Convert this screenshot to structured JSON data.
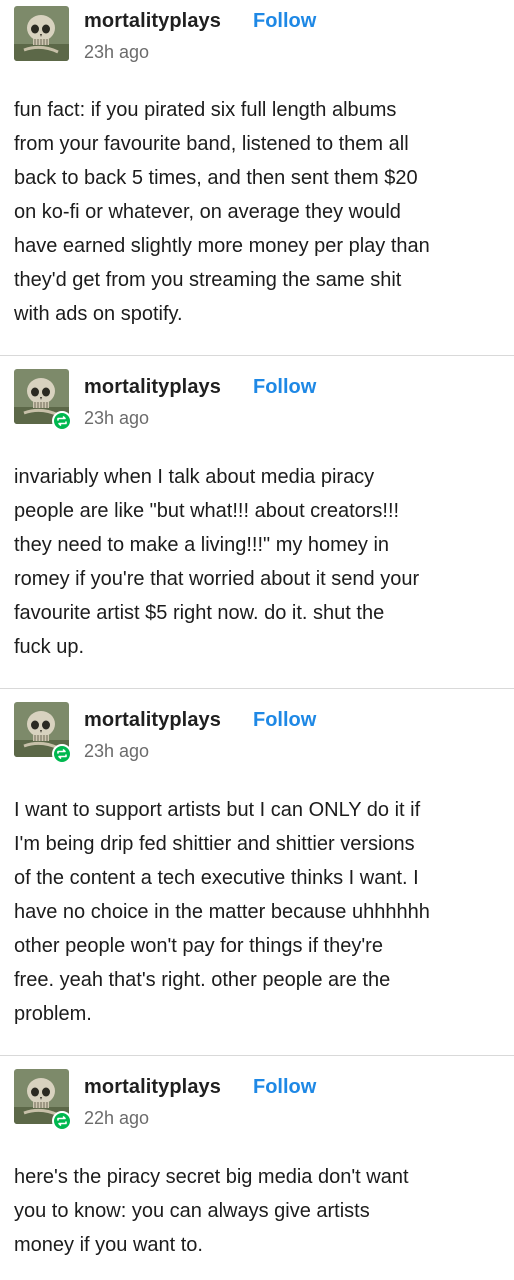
{
  "posts": [
    {
      "username": "mortalityplays",
      "follow_label": "Follow",
      "timestamp": "23h ago",
      "reblogged": false,
      "body": "fun fact: if you pirated six full length albums\nfrom your favourite band, listened to them all\nback to back 5 times, and then sent them $20\non ko-fi or whatever, on average they would\nhave earned slightly more money per play than\nthey'd get from you streaming the same shit\nwith ads on spotify."
    },
    {
      "username": "mortalityplays",
      "follow_label": "Follow",
      "timestamp": "23h ago",
      "reblogged": true,
      "body": "invariably when I talk about media piracy\npeople are like \"but what!!! about creators!!!\nthey need to make a living!!!\" my homey in\nromey if you're that worried about it send your\nfavourite artist $5 right now. do it. shut the\nfuck up."
    },
    {
      "username": "mortalityplays",
      "follow_label": "Follow",
      "timestamp": "23h ago",
      "reblogged": true,
      "body": "I want to support artists but I can ONLY do it if\nI'm being drip fed shittier and shittier versions\nof the content a tech executive thinks I want. I\nhave no choice in the matter because uhhhhhh\nother people won't pay for things if they're\nfree. yeah that's right. other people are the\nproblem."
    },
    {
      "username": "mortalityplays",
      "follow_label": "Follow",
      "timestamp": "22h ago",
      "reblogged": true,
      "body": "here's the piracy secret big media don't want\nyou to know: you can always give artists\nmoney if you want to."
    }
  ],
  "icons": {
    "avatar": "skull-avatar-icon",
    "reblog": "reblog-icon"
  },
  "colors": {
    "follow": "#1e88e5",
    "reblog_badge": "#00b84f",
    "divider": "#d9d9d9"
  }
}
